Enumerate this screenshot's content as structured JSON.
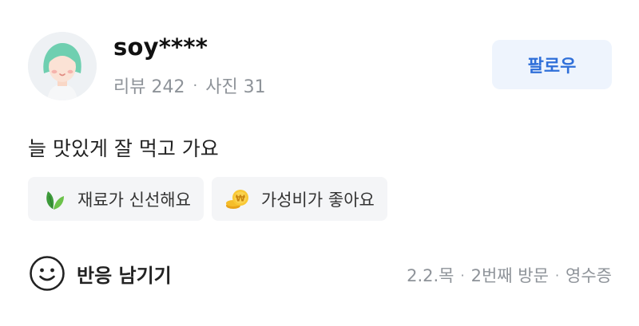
{
  "profile": {
    "username": "soy****",
    "reviews_label": "리뷰 242",
    "photos_label": "사진 31",
    "separator": "·",
    "avatar_icon": "user-avatar-icon"
  },
  "follow_button": {
    "label": "팔로우"
  },
  "review": {
    "text": "늘 맛있게 잘 먹고 가요",
    "tags": [
      {
        "label": "재료가 신선해요",
        "icon": "leaf-icon"
      },
      {
        "label": "가성비가 좋아요",
        "icon": "coin-icon"
      }
    ]
  },
  "footer": {
    "reaction_label": "반응 남기기",
    "reaction_icon": "smile-icon",
    "date": "2.2.목",
    "visit": "2번째 방문",
    "receipt": "영수증",
    "separator": "·"
  },
  "colors": {
    "accent": "#2f6fd9",
    "follow_bg": "#eef4fd",
    "tag_bg": "#f4f5f7",
    "muted_text": "#8e9399"
  }
}
